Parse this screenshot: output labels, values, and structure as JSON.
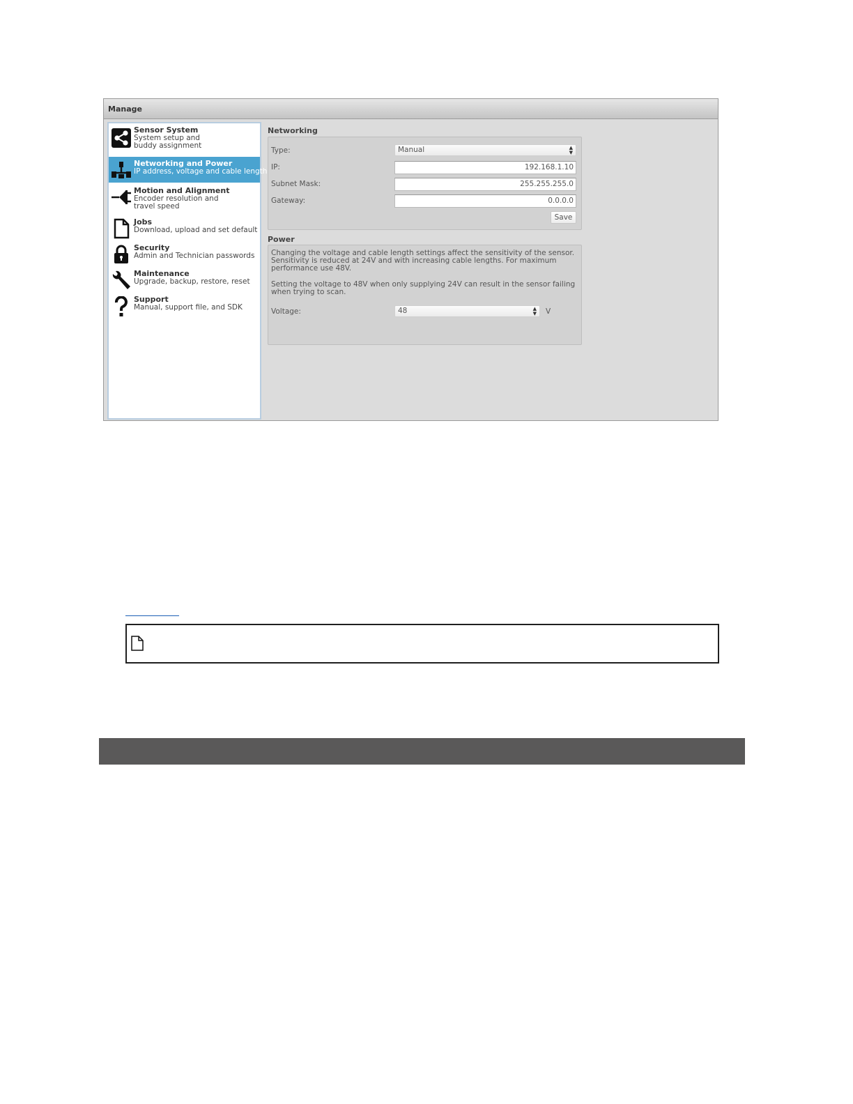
{
  "window": {
    "title": "Manage"
  },
  "sidebar": {
    "items": [
      {
        "title": "Sensor System",
        "desc": "System setup and buddy assignment",
        "icon": "share-icon",
        "active": false
      },
      {
        "title": "Networking and Power",
        "desc": "IP address, voltage and cable length",
        "icon": "network-icon",
        "active": true
      },
      {
        "title": "Motion and Alignment",
        "desc": "Encoder resolution and travel speed",
        "icon": "plug-icon",
        "active": false
      },
      {
        "title": "Jobs",
        "desc": "Download, upload and set default",
        "icon": "document-icon",
        "active": false
      },
      {
        "title": "Security",
        "desc": "Admin and Technician passwords",
        "icon": "lock-icon",
        "active": false
      },
      {
        "title": "Maintenance",
        "desc": "Upgrade, backup, restore, reset",
        "icon": "wrench-icon",
        "active": false
      },
      {
        "title": "Support",
        "desc": "Manual, support file, and SDK",
        "icon": "question-icon",
        "active": false
      }
    ]
  },
  "networking": {
    "title": "Networking",
    "type_label": "Type:",
    "type_value": "Manual",
    "ip_label": "IP:",
    "ip_value": "192.168.1.10",
    "subnet_label": "Subnet Mask:",
    "subnet_value": "255.255.255.0",
    "gateway_label": "Gateway:",
    "gateway_value": "0.0.0.0",
    "save_label": "Save"
  },
  "power": {
    "title": "Power",
    "para1": "Changing the voltage and cable length settings affect the sensitivity of the sensor. Sensitivity is reduced at 24V and with increasing cable lengths. For maximum performance use 48V.",
    "para2": "Setting the voltage to 48V when only supplying 24V can result in the sensor failing when trying to scan.",
    "voltage_label": "Voltage:",
    "voltage_value": "48",
    "voltage_unit": "V"
  },
  "colors": {
    "active_item": "#4aa3d0",
    "panel_bg": "#dcdcdc",
    "dark_bar": "#5a5959"
  }
}
